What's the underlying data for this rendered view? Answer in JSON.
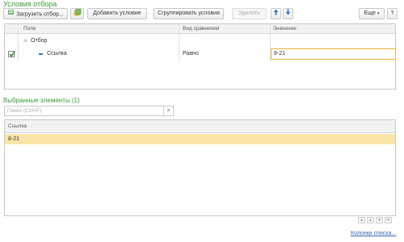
{
  "conditions": {
    "title": "Условия отбора",
    "toolbar": {
      "load": "Загрузить отбор...",
      "add": "Добавить условие",
      "group": "Сгруппировать условия",
      "delete": "Удалить",
      "more": "Еще",
      "help": "?"
    },
    "columns": {
      "field": "Поле",
      "compare": "Вид сравнения",
      "value": "Значение"
    },
    "group_row": {
      "label": "Отбор"
    },
    "rows": [
      {
        "checked": true,
        "field": "Ссылка",
        "compare": "Равно",
        "value": "8-21"
      }
    ]
  },
  "selected": {
    "title": "Выбранные элементы (1)",
    "search_placeholder": "Поиск (Ctrl+F)",
    "search_clear": "×",
    "column": "Ссылка",
    "rows": [
      "8-21"
    ],
    "columns_link": "Колонки списка..."
  },
  "colors": {
    "accent_green": "#3a9a3a",
    "selection": "#fbe5a8",
    "value_border": "#e8b43a"
  }
}
